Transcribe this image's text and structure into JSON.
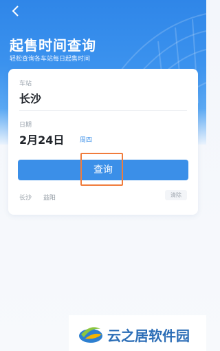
{
  "header": {
    "title": "起售时间查询",
    "subtitle": "轻松查询各车站每日起售时间"
  },
  "form": {
    "station_label": "车站",
    "station_value": "长沙",
    "date_label": "日期",
    "date_value": "2月24日",
    "weekday": "周四",
    "query_button": "查询"
  },
  "history": {
    "items": [
      "长沙",
      "益阳"
    ],
    "clear_label": "清除"
  },
  "watermark": {
    "text": "云之居软件园"
  },
  "colors": {
    "accent": "#3b8fe8",
    "highlight": "#f07c3c"
  }
}
